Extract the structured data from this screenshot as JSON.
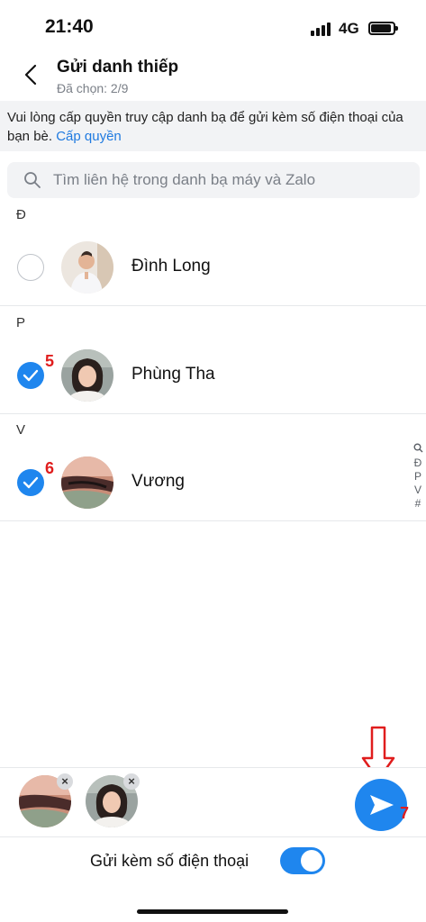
{
  "status_bar": {
    "time": "21:40",
    "network": "4G"
  },
  "header": {
    "title": "Gửi danh thiếp",
    "subtitle": "Đã chọn: 2/9"
  },
  "notice": {
    "text": "Vui lòng cấp quyền truy cập danh bạ để gửi kèm số điện thoại của bạn bè. ",
    "link": "Cấp quyền"
  },
  "search": {
    "placeholder": "Tìm liên hệ trong danh bạ máy và Zalo"
  },
  "sections": [
    {
      "letter": "Đ",
      "contacts": [
        {
          "name": "Đình Long",
          "checked": false
        }
      ]
    },
    {
      "letter": "P",
      "contacts": [
        {
          "name": "Phùng Tha",
          "checked": true,
          "step": "5"
        }
      ]
    },
    {
      "letter": "V",
      "contacts": [
        {
          "name": "Vương",
          "checked": true,
          "step": "6"
        }
      ]
    }
  ],
  "index_bar": [
    "Đ",
    "P",
    "V",
    "#"
  ],
  "bottom": {
    "remove_glyph": "×",
    "toggle_label": "Gửi kèm số điện thoại",
    "toggle_on": true,
    "send_step": "7"
  },
  "colors": {
    "accent": "#1f86ee",
    "link": "#1f7ae0",
    "annotation": "#e01d1d"
  }
}
